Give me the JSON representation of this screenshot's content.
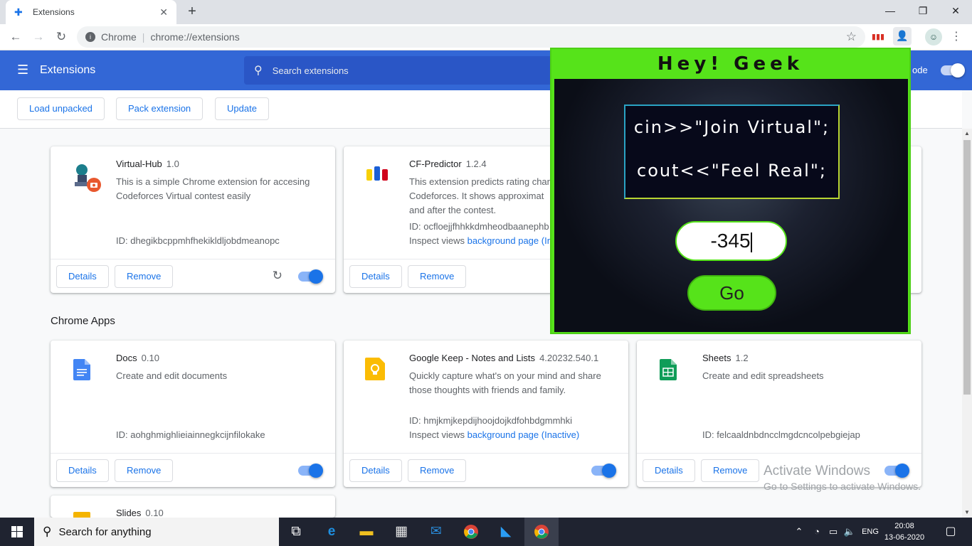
{
  "window": {
    "tab_title": "Extensions",
    "tab_close": "✕",
    "new_tab": "+",
    "minimize": "—",
    "restore": "❐",
    "close": "✕"
  },
  "toolbar": {
    "chip": "Chrome",
    "separator": "|",
    "url": "chrome://extensions",
    "back": "←",
    "forward": "→",
    "reload": "↻"
  },
  "header": {
    "title": "Extensions",
    "search_placeholder": "Search extensions",
    "dev_mode_label": "ode"
  },
  "subheader": {
    "load_unpacked": "Load unpacked",
    "pack_extension": "Pack extension",
    "update": "Update"
  },
  "extensions": [
    {
      "name": "Virtual-Hub",
      "version": "1.0",
      "description": "This is a simple Chrome extension for accesing Codeforces Virtual contest easily",
      "id": "ID: dhegikbcppmhfhekikldljobdmeanopc",
      "details": "Details",
      "remove": "Remove",
      "enabled": true
    },
    {
      "name": "CF-Predictor",
      "version": "1.2.4",
      "description": "This extension predicts rating char Codeforces. It shows approximat and after the contest.",
      "id": "ID: ocfloejjfhhkkdmheodbaanephb",
      "inspect_label": "Inspect views",
      "inspect_link": "background page (In",
      "details": "Details",
      "remove": "Remove"
    }
  ],
  "apps_section_title": "Chrome Apps",
  "apps": [
    {
      "name": "Docs",
      "version": "0.10",
      "description": "Create and edit documents",
      "id": "ID: aohghmighlieiainnegkcijnfilokake",
      "details": "Details",
      "remove": "Remove",
      "enabled": true,
      "color": "#4285f4"
    },
    {
      "name": "Google Keep - Notes and Lists",
      "version": "4.20232.540.1",
      "description": "Quickly capture what's on your mind and share those thoughts with friends and family.",
      "id": "ID: hmjkmjkepdijhoojdojkdfohbdgmmhki",
      "inspect_label": "Inspect views",
      "inspect_link": "background page (Inactive)",
      "details": "Details",
      "remove": "Remove",
      "enabled": true,
      "color": "#fbbc04"
    },
    {
      "name": "Sheets",
      "version": "1.2",
      "description": "Create and edit spreadsheets",
      "id": "ID: felcaaldnbdncclmgdcncolpebgiejap",
      "details": "Details",
      "remove": "Remove",
      "enabled": true,
      "color": "#0f9d58"
    },
    {
      "name": "Slides",
      "version": "0.10"
    }
  ],
  "popup": {
    "title": "Hey! Geek",
    "code_line1": "cin>>\"Join Virtual\";",
    "code_line2": "cout<<\"Feel Real\";",
    "input_value": "-345",
    "go_label": "Go",
    "accent": "#56e31a"
  },
  "watermark": {
    "line1": "Activate Windows",
    "line2": "Go to Settings to activate Windows."
  },
  "taskbar": {
    "search_placeholder": "Search for anything",
    "language": "ENG",
    "time": "20:08",
    "date": "13-06-2020"
  }
}
